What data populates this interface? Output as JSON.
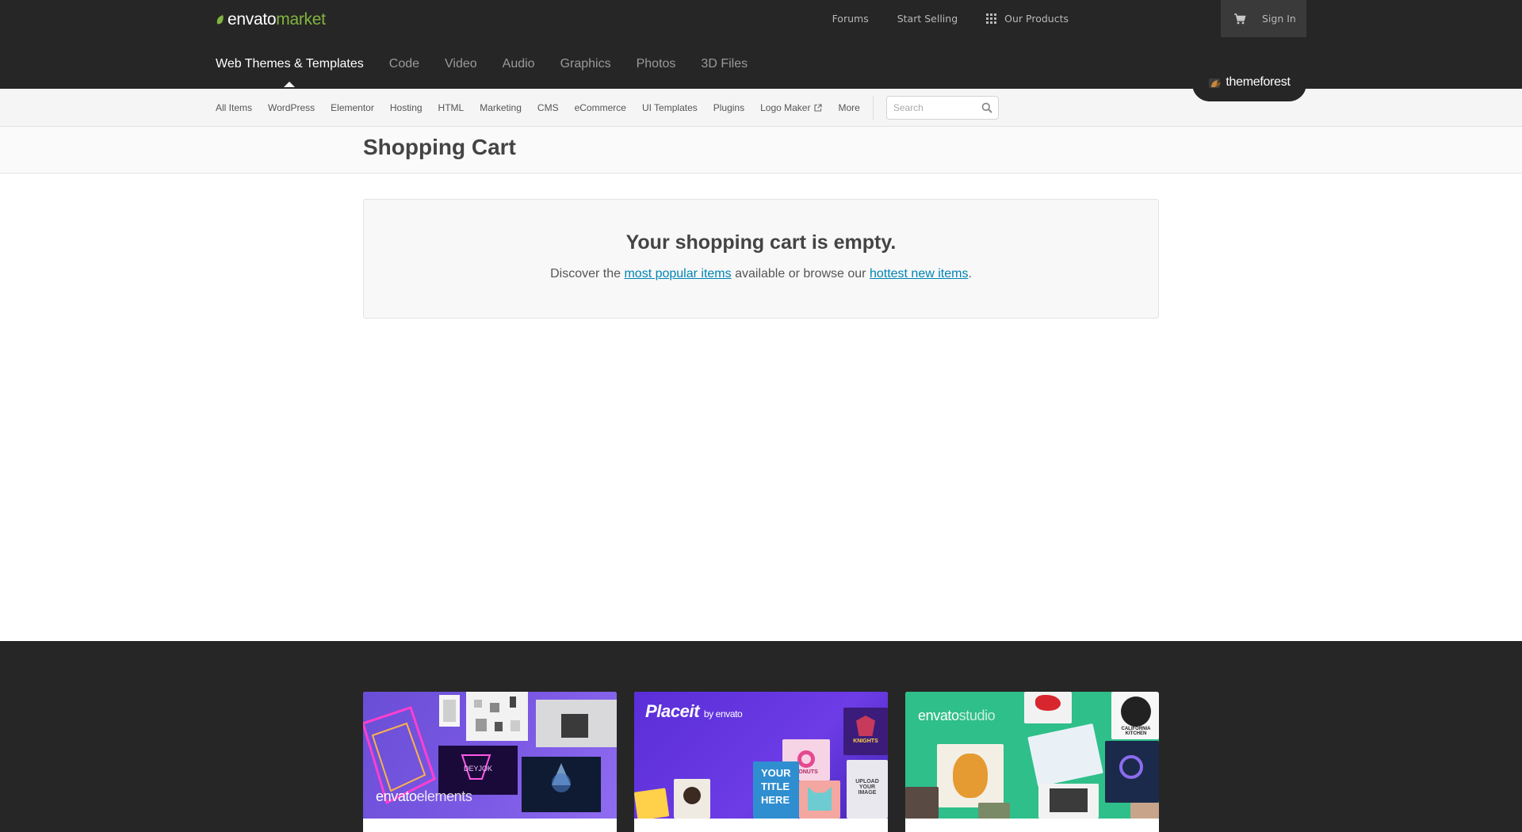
{
  "logo": {
    "part1": "envato",
    "part2": "market"
  },
  "top_nav": {
    "forums": "Forums",
    "start_selling": "Start Selling",
    "our_products": "Our Products",
    "sign_in": "Sign In"
  },
  "categories": [
    "Web Themes & Templates",
    "Code",
    "Video",
    "Audio",
    "Graphics",
    "Photos",
    "3D Files"
  ],
  "badge": {
    "text": "themeforest"
  },
  "sub_nav": {
    "items": [
      "All Items",
      "WordPress",
      "Elementor",
      "Hosting",
      "HTML",
      "Marketing",
      "CMS",
      "eCommerce",
      "UI Templates",
      "Plugins",
      "Logo Maker",
      "More"
    ],
    "search_placeholder": "Search"
  },
  "page": {
    "title": "Shopping Cart"
  },
  "empty_cart": {
    "heading": "Your shopping cart is empty.",
    "text_before": "Discover the ",
    "link1": "most popular items",
    "text_middle": " available or browse our ",
    "link2": "hottest new items",
    "text_after": "."
  },
  "promos": {
    "elements": {
      "brand1": "envato",
      "brand2": "elements"
    },
    "placeit": {
      "brand1": "Placeit",
      "brand2": "by envato",
      "poster_text": "YOUR TITLE HERE",
      "tile1": "DONUTS",
      "tile2": "KNIGHTS",
      "tile3": "UPLOAD YOUR IMAGE"
    },
    "studio": {
      "brand1": "envato",
      "brand2": "studio",
      "tile1": "CALIFORNIA KITCHEN"
    }
  },
  "colors": {
    "dark_bg": "#262626",
    "brand_green": "#82b440",
    "link_blue": "#0084b4"
  }
}
